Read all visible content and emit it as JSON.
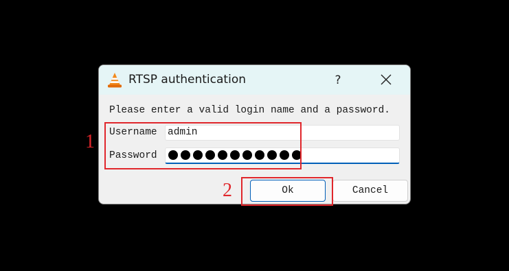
{
  "dialog": {
    "title": "RTSP authentication",
    "help_label": "?",
    "prompt": "Please enter a valid login name and a password.",
    "username_label": "Username",
    "username_value": "admin",
    "password_label": "Password",
    "password_dot_count": 11,
    "ok_label": "Ok",
    "cancel_label": "Cancel"
  },
  "annotations": {
    "marker_1": "1",
    "marker_2": "2",
    "color": "#e0262b"
  },
  "colors": {
    "titlebar": "#e5f5f6",
    "focus_accent": "#005fb8"
  },
  "icons": {
    "app": "vlc-cone-icon",
    "close": "close-icon"
  }
}
